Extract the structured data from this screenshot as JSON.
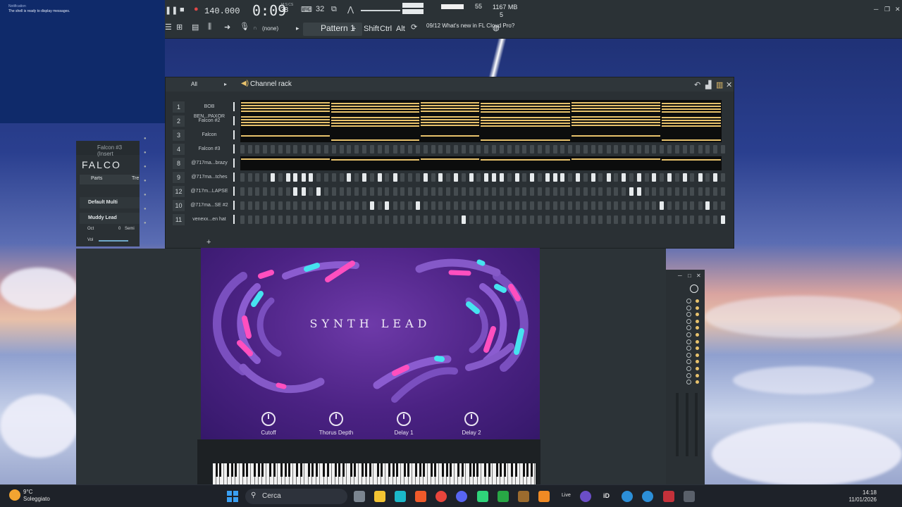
{
  "notification": {
    "line1": "Notification",
    "line2": "The shell is ready to display messages."
  },
  "toolbar": {
    "tempo": "140.000",
    "time_main": "0:09",
    "time_sub": "38",
    "time_label": "M:S:CS",
    "cpu": "55",
    "memory": "1167 MB",
    "polyphony": "5",
    "pattern": "Pattern 1",
    "mic_target": "(none)",
    "shift": "Shift",
    "ctrl": "Ctrl",
    "alt": "Alt",
    "news_date": "09/12",
    "news_text": "What's new in FL Cloud Pro?"
  },
  "channel_rack": {
    "filter": "All",
    "title": "Channel rack",
    "rows": [
      {
        "num": "1",
        "name": "BOB BEN...PAXOR",
        "kind": "roll"
      },
      {
        "num": "2",
        "name": "Falcon #2",
        "kind": "roll"
      },
      {
        "num": "3",
        "name": "Falcon",
        "kind": "roll"
      },
      {
        "num": "4",
        "name": "Falcon #3",
        "kind": "steps",
        "on": []
      },
      {
        "num": "8",
        "name": "@717ma...brazy",
        "kind": "roll"
      },
      {
        "num": "9",
        "name": "@717ma...tches",
        "kind": "steps",
        "on": [
          4,
          6,
          7,
          8,
          9,
          14,
          16,
          18,
          20,
          24,
          26,
          28,
          30,
          32,
          33,
          34,
          36,
          38,
          40,
          41,
          42,
          44,
          46,
          48,
          50,
          52,
          54,
          56,
          58,
          60,
          62
        ]
      },
      {
        "num": "12",
        "name": "@717m...LAPSE",
        "kind": "steps",
        "on": [
          7,
          8,
          10,
          51,
          52
        ]
      },
      {
        "num": "10",
        "name": "@717ma...SE #2",
        "kind": "steps",
        "on": [
          17,
          19,
          23,
          55,
          61
        ]
      },
      {
        "num": "11",
        "name": "venexx...en hat",
        "kind": "steps",
        "on": [
          29,
          63
        ]
      }
    ]
  },
  "falcon_panel": {
    "header": "Falcon #3 (Insert",
    "logo": "FALCO",
    "tab_parts": "Parts",
    "tab_tree": "Tre",
    "multi": "Default Multi",
    "program": "Muddy Lead",
    "oct_label": "Oct",
    "oct_value": "0",
    "semi_label": "Semi",
    "vol_label": "Vol"
  },
  "synth": {
    "title": "SYNTH LEAD",
    "knobs": [
      "Cutoff",
      "Thorus Depth",
      "Delay 1",
      "Delay 2"
    ]
  },
  "taskbar": {
    "temp": "9°C",
    "weather": "Soleggiato",
    "search_placeholder": "Cerca",
    "time": "14:18",
    "date": "11/01/2026",
    "live": "Live",
    "id_label": "iD"
  }
}
